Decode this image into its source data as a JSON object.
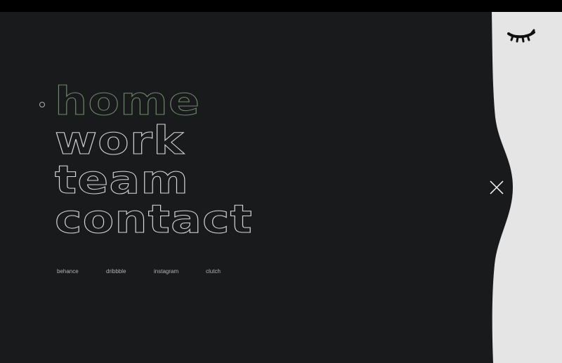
{
  "nav": {
    "items": [
      {
        "label": "home",
        "active": true
      },
      {
        "label": "work",
        "active": false
      },
      {
        "label": "team",
        "active": false
      },
      {
        "label": "contact",
        "active": false
      }
    ]
  },
  "social": {
    "links": [
      "behance",
      "dribbble",
      "instagram",
      "clutch"
    ]
  },
  "icons": {
    "logo": "closed-eye-logo-icon",
    "close": "close-icon",
    "active_indicator": "circle-indicator-icon"
  },
  "colors": {
    "menu_background": "#191a1c",
    "side_panel": "#e5e5e5",
    "nav_outline": "#d8d8d8",
    "nav_active_outline": "#6e8a6c",
    "social_text": "#b3b3b3"
  }
}
